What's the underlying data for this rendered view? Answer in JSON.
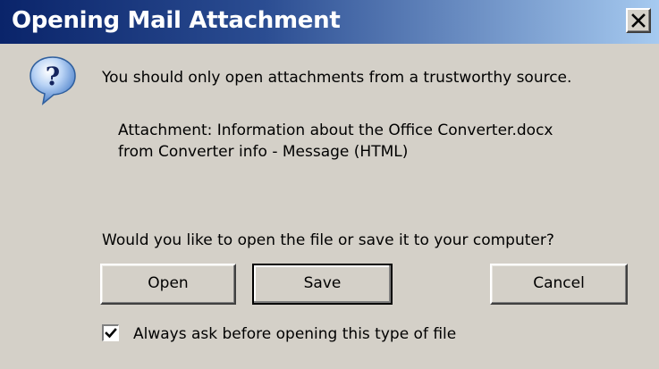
{
  "window": {
    "title": "Opening Mail Attachment",
    "close_icon": "close-icon"
  },
  "message": {
    "icon": "question-icon",
    "warning": "You should only open attachments from a trustworthy source.",
    "attachment_line": "Attachment: Information about the Office Converter.docx",
    "source_line": "from Converter info - Message (HTML)",
    "question": "Would you like to open the file or save it to your computer?"
  },
  "buttons": {
    "open": "Open",
    "save": "Save",
    "cancel": "Cancel"
  },
  "option": {
    "always_ask_label": "Always ask before opening this type of file",
    "always_ask_checked": true
  },
  "colors": {
    "title_bar_start": "#0a246a",
    "title_bar_end": "#a6caf0",
    "dialog_face": "#d4d0c8"
  }
}
